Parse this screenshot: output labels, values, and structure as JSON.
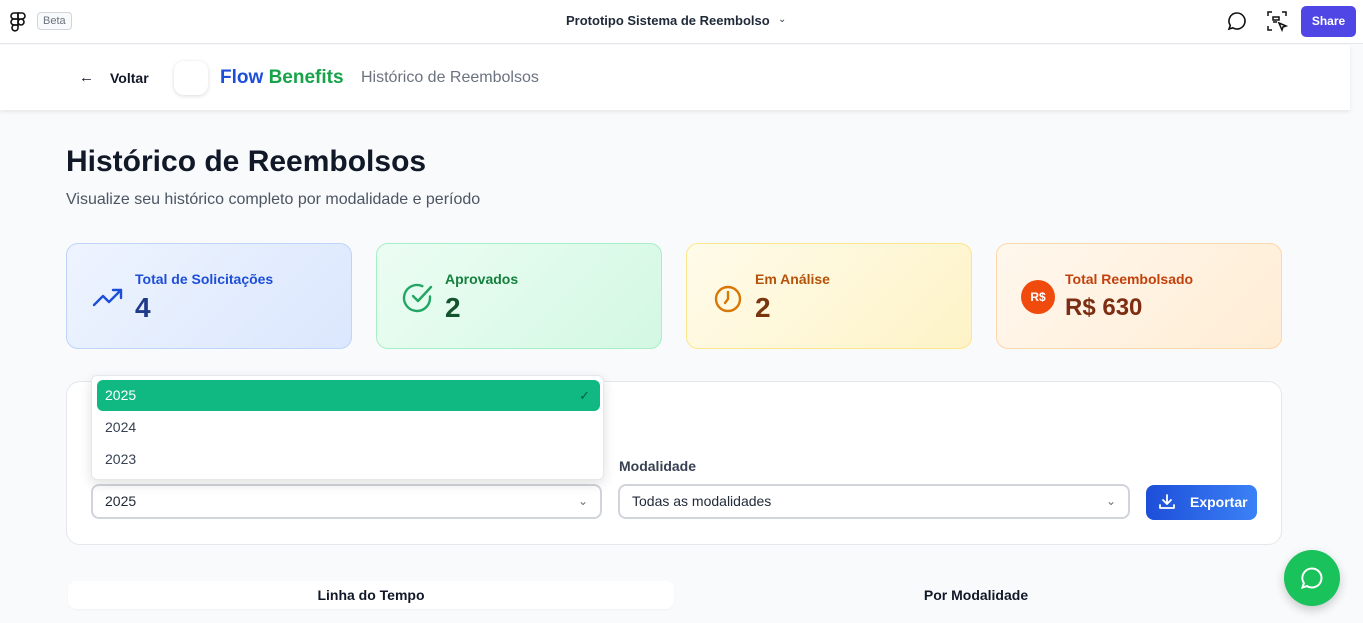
{
  "figma": {
    "beta_label": "Beta",
    "prototype_title": "Prototipo Sistema de Reembolso",
    "share_label": "Share"
  },
  "header": {
    "back_label": "Voltar",
    "brand_flow": "Flow",
    "brand_benefits": "Benefits",
    "subtitle": "Histórico de Reembolsos"
  },
  "page": {
    "title": "Histórico de Reembolsos",
    "subtitle": "Visualize seu histórico completo por modalidade e período"
  },
  "stats": {
    "total": {
      "label": "Total de Solicitações",
      "value": "4",
      "icon": "trending-up-icon"
    },
    "approved": {
      "label": "Aprovados",
      "value": "2",
      "icon": "check-circle-icon"
    },
    "analysis": {
      "label": "Em Análise",
      "value": "2",
      "icon": "clock-icon"
    },
    "reimbursed": {
      "label": "Total Reembolsado",
      "value": "R$ 630",
      "badge": "R$"
    }
  },
  "filters": {
    "year": {
      "value": "2025",
      "options": [
        "2025",
        "2024",
        "2023"
      ]
    },
    "modality": {
      "label": "Modalidade",
      "value": "Todas as modalidades"
    },
    "export_label": "Exportar"
  },
  "tabs": [
    "Linha do Tempo",
    "Por Modalidade"
  ],
  "colors": {
    "brand_blue": "#1d4ed8",
    "brand_green": "#16a34a",
    "selected_option": "#10b981",
    "share_button": "#4f46e5",
    "chat_fab": "#19c25a"
  }
}
